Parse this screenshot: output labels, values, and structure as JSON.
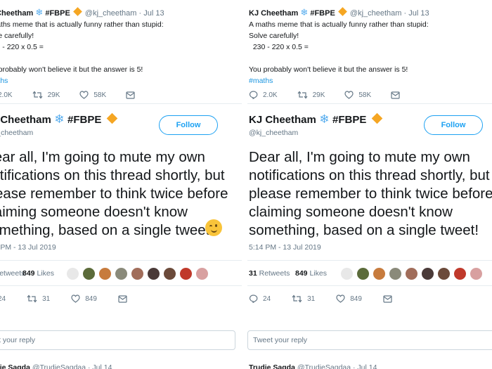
{
  "prev_tweet": {
    "name": "KJ Cheetham",
    "tag": "#FBPE",
    "handle_date": "@kj_cheetham · Jul 13",
    "line1": "A maths meme that is actually funny rather than stupid:",
    "line2": "Solve carefully!",
    "line3": "230 - 220 x 0.5 =",
    "line4": "You probably won't believe it but the answer is 5!",
    "hashtag": "#maths",
    "replies": "2.0K",
    "retweets": "29K",
    "likes": "58K"
  },
  "main_tweet": {
    "name": "KJ Cheetham",
    "tag": "#FBPE",
    "handle": "@kj_cheetham",
    "follow_label": "Follow",
    "text_line1": "Dear all, I'm going to mute my own",
    "text_line2": "notifications on this thread shortly, but",
    "text_line3": "please remember to think twice before",
    "text_line4": "claiming someone doesn't know",
    "text_line5": "something, based on a single tweet!",
    "timestamp": "5:14 PM - 13 Jul 2019",
    "retweet_count": "31",
    "retweet_label": "Retweets",
    "like_count": "849",
    "like_label": "Likes",
    "replies": "24",
    "retweets": "31",
    "likes": "849"
  },
  "reply_placeholder": "Tweet your reply",
  "next_tweet": {
    "name": "Trudie Sagda",
    "handle": "@TrudieSagdaa · Jul 14"
  },
  "colors": {
    "accent": "#1da1f2",
    "hashtag": "#1b95e0",
    "muted": "#657786",
    "text": "#14171a",
    "avatars": [
      "#e8e8e8",
      "#5b6b3a",
      "#c77b3d",
      "#8a8a7a",
      "#a16d5a",
      "#4a3a38",
      "#6b4a3a",
      "#c0392b",
      "#d8a0a0"
    ]
  }
}
